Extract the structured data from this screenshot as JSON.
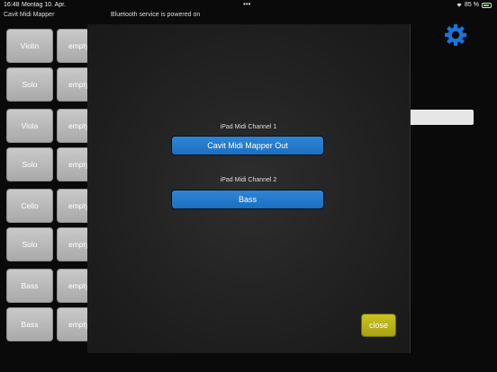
{
  "status_bar": {
    "time": "16:48",
    "date": "Montag 10. Apr.",
    "dots": "•••",
    "battery_text": "85 %",
    "battery_level": 0.85
  },
  "app": {
    "title": "Cavit Midi Mapper",
    "bluetooth_status": "Bluetooth service is powered on"
  },
  "tiles": {
    "col1": [
      "Violin",
      "Solo",
      "Viola",
      "Solo",
      "Cello",
      "Solo",
      "Bass",
      "Bass"
    ],
    "col2": [
      "empty",
      "empty",
      "empty",
      "empty",
      "empty",
      "empty",
      "empty",
      "empty"
    ]
  },
  "modal": {
    "channel1_label": "iPad Midi Channel 1",
    "channel1_value": "Cavit Midi Mapper Out",
    "channel2_label": "iPad Midi Channel 2",
    "channel2_value": "Bass",
    "close_label": "close"
  },
  "colors": {
    "accent_blue": "#1c6fc0",
    "close_yellow": "#bdb61a",
    "gear_blue": "#1e73d8"
  }
}
